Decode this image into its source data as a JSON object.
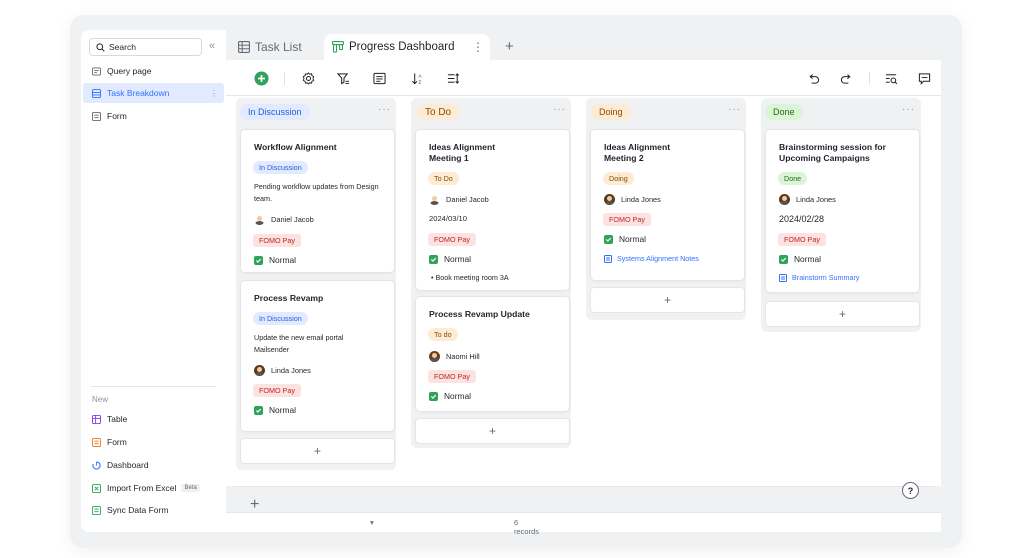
{
  "sidebar": {
    "search_placeholder": "Search",
    "collapse_icon": "double-chevron-left-icon",
    "items": [
      {
        "label": "Query page",
        "icon": "query-page-icon"
      },
      {
        "label": "Task Breakdown",
        "icon": "table-icon",
        "active": true
      },
      {
        "label": "Form",
        "icon": "form-icon"
      }
    ],
    "new_label": "New",
    "new_items": [
      {
        "label": "Table",
        "icon": "table-icon",
        "color": "#7f3bf5"
      },
      {
        "label": "Form",
        "icon": "form-icon",
        "color": "#e8761f"
      },
      {
        "label": "Dashboard",
        "icon": "dashboard-icon",
        "color": "#3370ff"
      },
      {
        "label": "Import From Excel",
        "icon": "excel-icon",
        "color": "#2fa35a",
        "badge": "Beta"
      },
      {
        "label": "Sync Data Form",
        "icon": "sync-form-icon",
        "color": "#2fa35a"
      }
    ]
  },
  "tabs": [
    {
      "label": "Task List",
      "icon": "grid-icon"
    },
    {
      "label": "Progress Dashboard",
      "icon": "kanban-icon",
      "active": true
    }
  ],
  "colors": {
    "accent": "#3370ff",
    "add_button": "#2fa35a",
    "in_discussion_bg": "#e1eaff",
    "to_do_bg": "#fdebd3",
    "doing_bg": "#fdebd3",
    "done_bg": "#d9f5d6",
    "tag_red_bg": "#fde2e2"
  },
  "columns": [
    {
      "title": "In Discussion",
      "cards": [
        {
          "title": "Workflow Alignment",
          "status": "In Discussion",
          "description": "Pending workflow updates from Design team.",
          "assignee": "Daniel Jacob",
          "tag": "FOMO Pay",
          "priority": "Normal"
        },
        {
          "title": "Process Revamp",
          "status": "In Discussion",
          "description": "Update the new email portal Mailsender",
          "assignee": "Linda Jones",
          "tag": "FOMO Pay",
          "priority": "Normal"
        }
      ]
    },
    {
      "title": "To Do",
      "cards": [
        {
          "title": "Ideas Alignment Meeting 1",
          "status": "To Do",
          "assignee": "Daniel Jacob",
          "date": "2024/03/10",
          "tag": "FOMO Pay",
          "priority": "Normal",
          "bullet": "Book meeting room 3A"
        },
        {
          "title": "Process Revamp Update",
          "status": "To do",
          "assignee": "Naomi Hill",
          "tag": "FOMO Pay",
          "priority": "Normal"
        }
      ]
    },
    {
      "title": "Doing",
      "cards": [
        {
          "title": "Ideas Alignment Meeting 2",
          "status": "Doing",
          "assignee": "Linda Jones",
          "tag": "FOMO Pay",
          "priority": "Normal",
          "link": "Systems Alignment Notes"
        }
      ]
    },
    {
      "title": "Done",
      "cards": [
        {
          "title": "Brainstorming session for Upcoming Campaigns",
          "status": "Done",
          "assignee": "Linda Jones",
          "date": "2024/02/28",
          "tag": "FOMO Pay",
          "priority": "Normal",
          "link": "Brainstorm Summary"
        }
      ]
    }
  ],
  "add_card_label": "+",
  "footer": {
    "records": "6 records"
  }
}
